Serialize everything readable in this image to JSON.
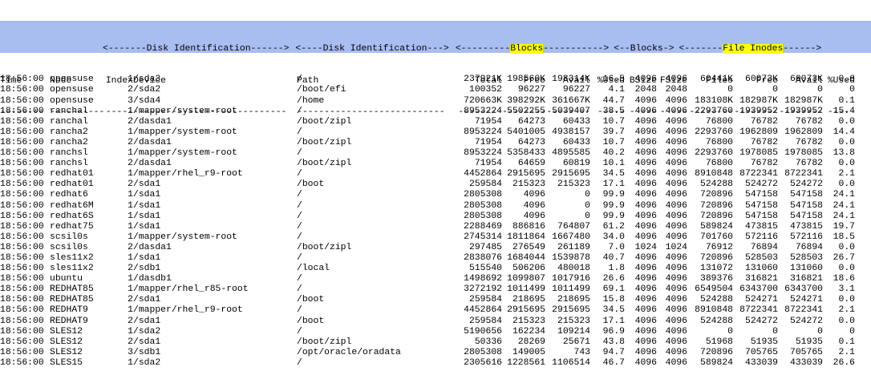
{
  "header": {
    "group_line": {
      "disk_id_1": "<-------Disk Identification------>",
      "disk_id_2": "<----Disk Identification--->",
      "blocks_pre": "<---------",
      "blocks_hl": "Blocks",
      "blocks_post": "----------->",
      "bsize_group": "<--Blocks->",
      "inodes_pre": "<-------",
      "inodes_hl": "File Inodes",
      "inodes_post": "------>"
    },
    "columns": [
      "Time",
      "Node",
      "Index",
      "Device",
      "Path",
      "Total",
      "Free",
      "Avail",
      "%Used",
      "BSize",
      "FSize",
      "Files",
      "Free",
      "Avail",
      "%Used"
    ],
    "dashes": [
      "--------",
      "----------",
      "-----",
      "----------------------------",
      "---------------------------",
      "--------",
      "--------",
      "--------",
      "-----",
      "-----",
      "-----",
      "--------",
      "--------",
      "--------",
      "-----"
    ]
  },
  "rows": [
    [
      "18:56:00",
      "opensuse",
      "1",
      "/sda3",
      "/",
      "237921K",
      "198560K",
      "198314K",
      "16.5",
      "4096",
      "4096",
      "60441K",
      "60073K",
      "60073K",
      "0.6"
    ],
    [
      "18:56:00",
      "opensuse",
      "2",
      "/sda2",
      "/boot/efi",
      "100352",
      "96227",
      "96227",
      "4.1",
      "2048",
      "2048",
      "0",
      "0",
      "0",
      "0"
    ],
    [
      "18:56:00",
      "opensuse",
      "3",
      "/sda4",
      "/home",
      "720663K",
      "398292K",
      "361667K",
      "44.7",
      "4096",
      "4096",
      "183108K",
      "182987K",
      "182987K",
      "0.1"
    ],
    [
      "18:56:00",
      "ranchal",
      "1",
      "/mapper/system-root",
      "/",
      "8953224",
      "5502255",
      "5039407",
      "38.5",
      "4096",
      "4096",
      "2293760",
      "1939952",
      "1939952",
      "15.4"
    ],
    [
      "18:56:00",
      "ranchal",
      "2",
      "/dasda1",
      "/boot/zipl",
      "71954",
      "64273",
      "60433",
      "10.7",
      "4096",
      "4096",
      "76800",
      "76782",
      "76782",
      "0.0"
    ],
    [
      "18:56:00",
      "rancha2",
      "1",
      "/mapper/system-root",
      "/",
      "8953224",
      "5401005",
      "4938157",
      "39.7",
      "4096",
      "4096",
      "2293760",
      "1962809",
      "1962809",
      "14.4"
    ],
    [
      "18:56:00",
      "rancha2",
      "2",
      "/dasda1",
      "/boot/zipl",
      "71954",
      "64273",
      "60433",
      "10.7",
      "4096",
      "4096",
      "76800",
      "76782",
      "76782",
      "0.0"
    ],
    [
      "18:56:00",
      "ranchsl",
      "1",
      "/mapper/system-root",
      "/",
      "8953224",
      "5358433",
      "4895585",
      "40.2",
      "4096",
      "4096",
      "2293760",
      "1978085",
      "1978085",
      "13.8"
    ],
    [
      "18:56:00",
      "ranchsl",
      "2",
      "/dasda1",
      "/boot/zipl",
      "71954",
      "64659",
      "60819",
      "10.1",
      "4096",
      "4096",
      "76800",
      "76782",
      "76782",
      "0.0"
    ],
    [
      "18:56:00",
      "redhat01",
      "1",
      "/mapper/rhel_r9-root",
      "/",
      "4452864",
      "2915695",
      "2915695",
      "34.5",
      "4096",
      "4096",
      "8910848",
      "8722341",
      "8722341",
      "2.1"
    ],
    [
      "18:56:00",
      "redhat01",
      "2",
      "/sda1",
      "/boot",
      "259584",
      "215323",
      "215323",
      "17.1",
      "4096",
      "4096",
      "524288",
      "524272",
      "524272",
      "0.0"
    ],
    [
      "18:56:00",
      "redhat6",
      "1",
      "/sda1",
      "/",
      "2805308",
      "4096",
      "0",
      "99.9",
      "4096",
      "4096",
      "720896",
      "547158",
      "547158",
      "24.1"
    ],
    [
      "18:56:00",
      "redhat6M",
      "1",
      "/sda1",
      "/",
      "2805308",
      "4096",
      "0",
      "99.9",
      "4096",
      "4096",
      "720896",
      "547158",
      "547158",
      "24.1"
    ],
    [
      "18:56:00",
      "redhat6S",
      "1",
      "/sda1",
      "/",
      "2805308",
      "4096",
      "0",
      "99.9",
      "4096",
      "4096",
      "720896",
      "547158",
      "547158",
      "24.1"
    ],
    [
      "18:56:00",
      "redhat75",
      "1",
      "/sda1",
      "/",
      "2288469",
      "886816",
      "764807",
      "61.2",
      "4096",
      "4096",
      "589824",
      "473815",
      "473815",
      "19.7"
    ],
    [
      "18:56:00",
      "scsil0s",
      "1",
      "/mapper/system-root",
      "/",
      "2745314",
      "1811864",
      "1667480",
      "34.0",
      "4096",
      "4096",
      "701760",
      "572116",
      "572116",
      "18.5"
    ],
    [
      "18:56:00",
      "scsil0s",
      "2",
      "/dasda1",
      "/boot/zipl",
      "297485",
      "276549",
      "261189",
      "7.0",
      "1024",
      "1024",
      "76912",
      "76894",
      "76894",
      "0.0"
    ],
    [
      "18:56:00",
      "sles11x2",
      "1",
      "/sda1",
      "/",
      "2838076",
      "1684044",
      "1539878",
      "40.7",
      "4096",
      "4096",
      "720896",
      "528503",
      "528503",
      "26.7"
    ],
    [
      "18:56:00",
      "sles11x2",
      "2",
      "/sdb1",
      "/local",
      "515540",
      "506206",
      "480018",
      "1.8",
      "4096",
      "4096",
      "131072",
      "131060",
      "131060",
      "0.0"
    ],
    [
      "18:56:00",
      "ubuntu",
      "1",
      "/dasdb1",
      "/",
      "1498692",
      "1099807",
      "1017916",
      "26.6",
      "4096",
      "4096",
      "389376",
      "316821",
      "316821",
      "18.6"
    ],
    [
      "18:56:00",
      "REDHAT85",
      "1",
      "/mapper/rhel_r85-root",
      "/",
      "3272192",
      "1011499",
      "1011499",
      "69.1",
      "4096",
      "4096",
      "6549504",
      "6343700",
      "6343700",
      "3.1"
    ],
    [
      "18:56:00",
      "REDHAT85",
      "2",
      "/sda1",
      "/boot",
      "259584",
      "218695",
      "218695",
      "15.8",
      "4096",
      "4096",
      "524288",
      "524271",
      "524271",
      "0.0"
    ],
    [
      "18:56:00",
      "REDHAT9",
      "1",
      "/mapper/rhel_r9-root",
      "/",
      "4452864",
      "2915695",
      "2915695",
      "34.5",
      "4096",
      "4096",
      "8910848",
      "8722341",
      "8722341",
      "2.1"
    ],
    [
      "18:56:00",
      "REDHAT9",
      "2",
      "/sda1",
      "/boot",
      "259584",
      "215323",
      "215323",
      "17.1",
      "4096",
      "4096",
      "524288",
      "524272",
      "524272",
      "0.0"
    ],
    [
      "18:56:00",
      "SLES12",
      "1",
      "/sda2",
      "/",
      "5190656",
      "162234",
      "109214",
      "96.9",
      "4096",
      "4096",
      "0",
      "0",
      "0",
      "0"
    ],
    [
      "18:56:00",
      "SLES12",
      "2",
      "/sda1",
      "/boot/zipl",
      "50336",
      "28269",
      "25671",
      "43.8",
      "4096",
      "4096",
      "51968",
      "51935",
      "51935",
      "0.1"
    ],
    [
      "18:56:00",
      "SLES12",
      "3",
      "/sdb1",
      "/opt/oracle/oradata",
      "2805308",
      "149005",
      "743",
      "94.7",
      "4096",
      "4096",
      "720896",
      "705765",
      "705765",
      "2.1"
    ],
    [
      "18:56:00",
      "SLES15",
      "1",
      "/sda2",
      "/",
      "2305616",
      "1228561",
      "1106514",
      "46.7",
      "4096",
      "4096",
      "589824",
      "433039",
      "433039",
      "26.6"
    ]
  ]
}
